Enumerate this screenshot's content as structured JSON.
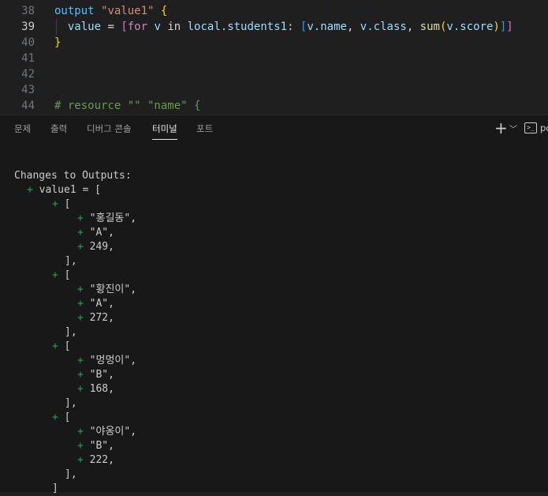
{
  "editor": {
    "lines": [
      {
        "num": "38",
        "current": false,
        "indent": "",
        "tokens": [
          {
            "t": "output",
            "c": "kw"
          },
          {
            "t": " ",
            "c": "plain"
          },
          {
            "t": "\"value1\"",
            "c": "str"
          },
          {
            "t": " ",
            "c": "plain"
          },
          {
            "t": "{",
            "c": "brace"
          }
        ]
      },
      {
        "num": "39",
        "current": true,
        "indent": "  ",
        "tokens": [
          {
            "t": "value",
            "c": "var"
          },
          {
            "t": " = ",
            "c": "plain"
          },
          {
            "t": "[",
            "c": "brk"
          },
          {
            "t": "for",
            "c": "ctl"
          },
          {
            "t": " v ",
            "c": "var"
          },
          {
            "t": "in",
            "c": "plain"
          },
          {
            "t": " local.students1",
            "c": "var"
          },
          {
            "t": ": ",
            "c": "plain"
          },
          {
            "t": "[",
            "c": "brk2"
          },
          {
            "t": "v.name",
            "c": "var"
          },
          {
            "t": ", ",
            "c": "plain"
          },
          {
            "t": "v.class",
            "c": "var"
          },
          {
            "t": ", ",
            "c": "plain"
          },
          {
            "t": "sum",
            "c": "fn"
          },
          {
            "t": "(",
            "c": "brace"
          },
          {
            "t": "v.score",
            "c": "var"
          },
          {
            "t": ")",
            "c": "brace"
          },
          {
            "t": "]",
            "c": "brk2"
          },
          {
            "t": "]",
            "c": "brk"
          }
        ]
      },
      {
        "num": "40",
        "current": false,
        "indent": "",
        "tokens": [
          {
            "t": "}",
            "c": "brace"
          }
        ]
      },
      {
        "num": "41",
        "current": false,
        "indent": "",
        "tokens": []
      },
      {
        "num": "42",
        "current": false,
        "indent": "",
        "tokens": []
      },
      {
        "num": "43",
        "current": false,
        "indent": "",
        "tokens": []
      },
      {
        "num": "44",
        "current": false,
        "indent": "",
        "tokens": [
          {
            "t": "# resource \"\" \"name\" {",
            "c": "cmt"
          }
        ]
      }
    ]
  },
  "panel": {
    "tabs": [
      {
        "label": "문제",
        "active": false
      },
      {
        "label": "출력",
        "active": false
      },
      {
        "label": "디버그 콘솔",
        "active": false
      },
      {
        "label": "터미널",
        "active": true
      },
      {
        "label": "포트",
        "active": false
      }
    ],
    "new_terminal_icon": "plus-icon",
    "dropdown_icon": "chevron-down-icon",
    "terminal_icon": "terminal-icon",
    "terminal_label": "pc"
  },
  "terminal": {
    "lines": [
      {
        "plus": false,
        "indent": 0,
        "text": ""
      },
      {
        "plus": false,
        "indent": 0,
        "text": "Changes to Outputs:"
      },
      {
        "plus": true,
        "indent": 2,
        "text": "value1 = ["
      },
      {
        "plus": true,
        "indent": 6,
        "text": "["
      },
      {
        "plus": true,
        "indent": 10,
        "text": "\"홍길동\","
      },
      {
        "plus": true,
        "indent": 10,
        "text": "\"A\","
      },
      {
        "plus": true,
        "indent": 10,
        "text": "249,"
      },
      {
        "plus": false,
        "indent": 8,
        "text": "],"
      },
      {
        "plus": true,
        "indent": 6,
        "text": "["
      },
      {
        "plus": true,
        "indent": 10,
        "text": "\"황진이\","
      },
      {
        "plus": true,
        "indent": 10,
        "text": "\"A\","
      },
      {
        "plus": true,
        "indent": 10,
        "text": "272,"
      },
      {
        "plus": false,
        "indent": 8,
        "text": "],"
      },
      {
        "plus": true,
        "indent": 6,
        "text": "["
      },
      {
        "plus": true,
        "indent": 10,
        "text": "\"멍멍이\","
      },
      {
        "plus": true,
        "indent": 10,
        "text": "\"B\","
      },
      {
        "plus": true,
        "indent": 10,
        "text": "168,"
      },
      {
        "plus": false,
        "indent": 8,
        "text": "],"
      },
      {
        "plus": true,
        "indent": 6,
        "text": "["
      },
      {
        "plus": true,
        "indent": 10,
        "text": "\"야옹이\","
      },
      {
        "plus": true,
        "indent": 10,
        "text": "\"B\","
      },
      {
        "plus": true,
        "indent": 10,
        "text": "222,"
      },
      {
        "plus": false,
        "indent": 8,
        "text": "],"
      },
      {
        "plus": false,
        "indent": 6,
        "text": "]"
      }
    ]
  }
}
